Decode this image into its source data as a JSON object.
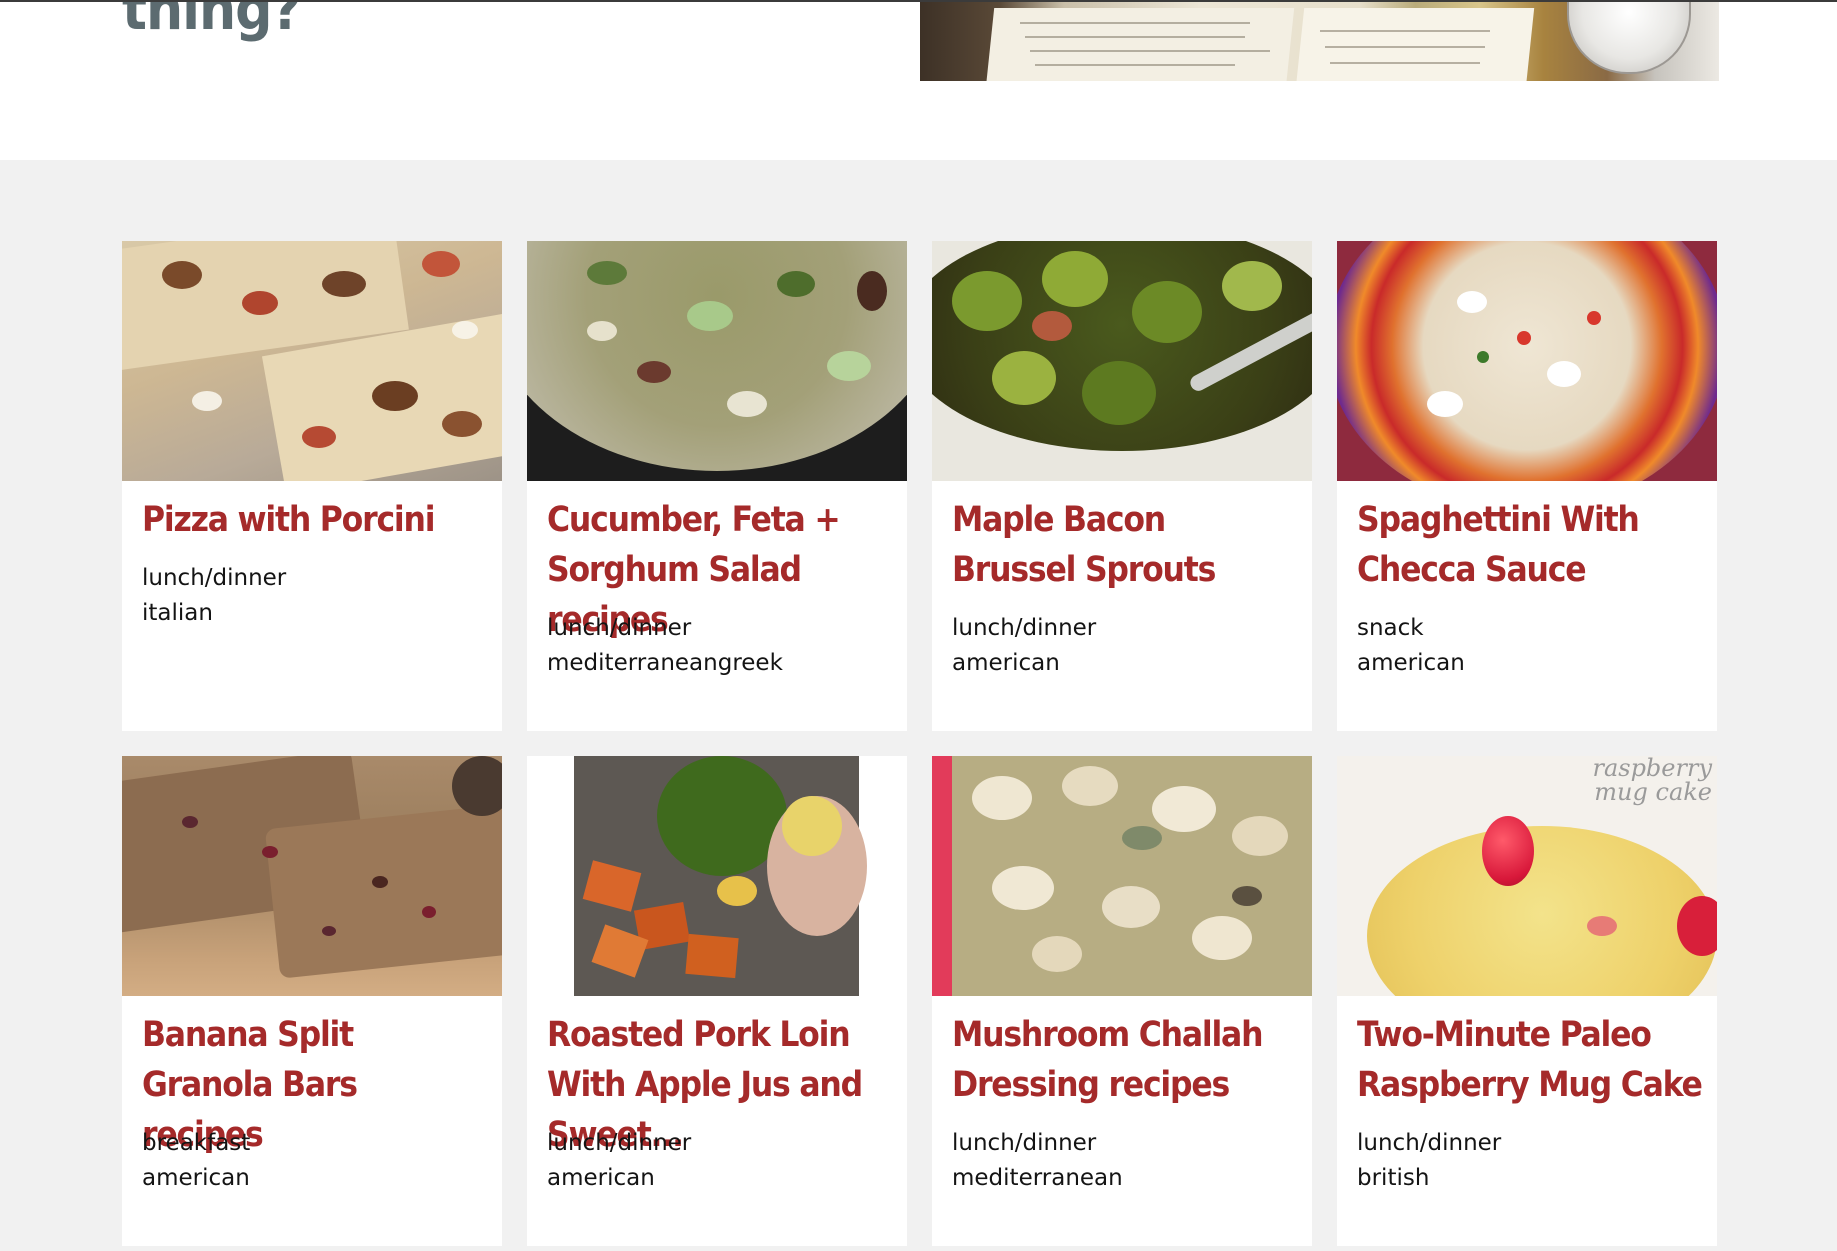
{
  "hero": {
    "heading": "thing?"
  },
  "recipes": [
    {
      "title": "Pizza with Porcini",
      "meal": "lunch/dinner",
      "cuisine": "italian"
    },
    {
      "title": "Cucumber, Feta + Sorghum Salad recipes",
      "meal": "lunch/dinner",
      "cuisine": "mediterraneangreek"
    },
    {
      "title": "Maple Bacon Brussel Sprouts",
      "meal": "lunch/dinner",
      "cuisine": "american"
    },
    {
      "title": "Spaghettini With Checca Sauce",
      "meal": "snack",
      "cuisine": "american"
    },
    {
      "title": "Banana Split Granola Bars recipes",
      "meal": "breakfast",
      "cuisine": "american"
    },
    {
      "title": "Roasted Pork Loin With Apple Jus and Sweet...",
      "meal": "lunch/dinner",
      "cuisine": "american"
    },
    {
      "title": "Mushroom Challah Dressing recipes",
      "meal": "lunch/dinner",
      "cuisine": "mediterranean"
    },
    {
      "title": "Two-Minute Paleo Raspberry Mug Cake",
      "meal": "lunch/dinner",
      "cuisine": "british"
    }
  ],
  "image_text": {
    "mug_cake_watermark": "raspberry mug cake"
  },
  "colors": {
    "title": "#a52a2a",
    "hero_heading": "#5c6b70",
    "section_background": "#f1f1f1",
    "card_background": "#ffffff"
  }
}
